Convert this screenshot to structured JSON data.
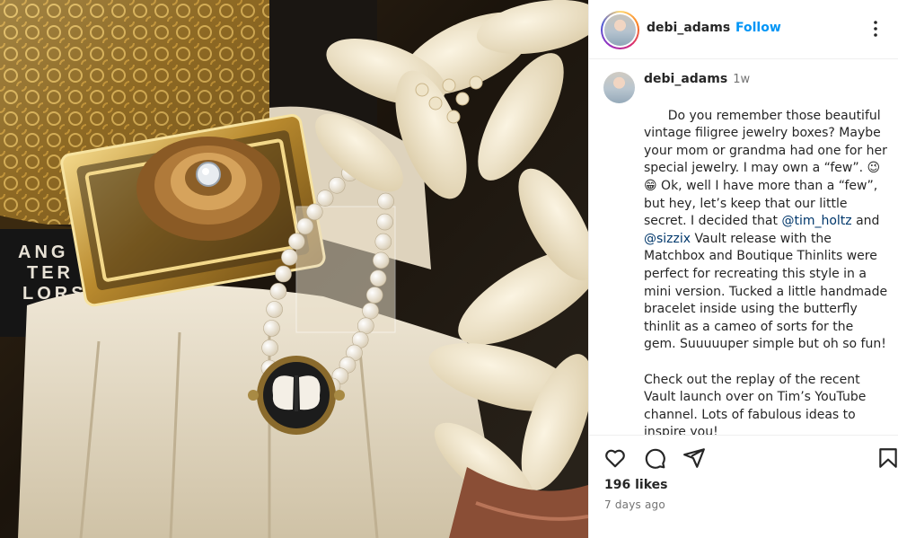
{
  "post": {
    "username": "debi_adams",
    "separator": "·",
    "follow_label": "Follow",
    "more_icon": "more-options-icon"
  },
  "caption": {
    "username": "debi_adams",
    "time_ago": "1w",
    "segments": [
      {
        "text": "Do you remember those beautiful vintage filigree jewelry boxes? Maybe your mom or grandma had one for her special jewelry. I may own a “few”. 😉 😁 Ok, well I have more than a “few”, but hey, let’s keep that our little secret. I decided that "
      },
      {
        "text": "@tim_holtz",
        "mention": true
      },
      {
        "text": " and "
      },
      {
        "text": "@sizzix",
        "mention": true
      },
      {
        "text": " Vault release with the Matchbox and Boutique Thinlits were perfect for recreating this style in a mini version. Tucked a little handmade bracelet inside using the butterfly thinlit as a cameo of sorts for the gem. Suuuuuper simple but oh so fun!\n\nCheck out the replay of the recent Vault launch over on Tim’s YouTube channel. Lots of fabulous ideas to inspire you!"
      }
    ]
  },
  "actions": {
    "icons": [
      "heart-icon",
      "comment-icon",
      "share-icon",
      "bookmark-icon"
    ],
    "likes_label": "196 likes",
    "posted": "7 days ago"
  },
  "photo": {
    "box_label": [
      "ANG",
      "TER",
      "LORS"
    ]
  },
  "colors": {
    "follow": "#0095f6",
    "mention": "#00376b",
    "muted": "#737373"
  }
}
